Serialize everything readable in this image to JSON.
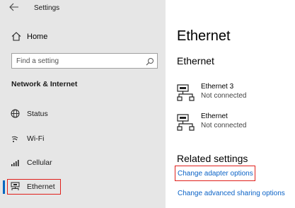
{
  "window": {
    "title": "Settings"
  },
  "sidebar": {
    "home_label": "Home",
    "search_placeholder": "Find a setting",
    "section_header": "Network & Internet",
    "items": [
      {
        "label": "Status",
        "icon": "globe-icon"
      },
      {
        "label": "Wi-Fi",
        "icon": "wifi-icon"
      },
      {
        "label": "Cellular",
        "icon": "signal-bars-icon"
      },
      {
        "label": "Ethernet",
        "icon": "ethernet-icon",
        "selected": true
      }
    ]
  },
  "main": {
    "page_title": "Ethernet",
    "subhead": "Ethernet",
    "connections": [
      {
        "name": "Ethernet 3",
        "status": "Not connected",
        "icon": "ethernet-icon"
      },
      {
        "name": "Ethernet",
        "status": "Not connected",
        "icon": "ethernet-icon"
      }
    ],
    "related_title": "Related settings",
    "links": {
      "adapter": "Change adapter options",
      "sharing": "Change advanced sharing options"
    }
  },
  "colors": {
    "sidebar_bg": "#e6e6e6",
    "accent": "#0067c0",
    "link": "#0b63c7",
    "highlight_border": "#e0201b"
  }
}
